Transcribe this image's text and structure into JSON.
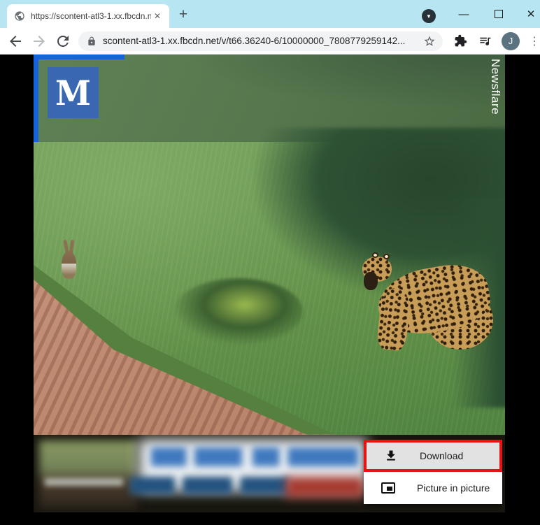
{
  "window": {
    "tab_title": "https://scontent-atl3-1.xx.fbcdn.n",
    "icons": {
      "tab_close": "✕",
      "new_tab": "+",
      "chevron_down": "▼",
      "minimize": "—",
      "close": "✕",
      "menu_dots": "⋮"
    }
  },
  "toolbar": {
    "url": "scontent-atl3-1.xx.fbcdn.net/v/t66.36240-6/10000000_7808779259142...",
    "avatar_initial": "J"
  },
  "video": {
    "brand_letter": "M",
    "watermark": "Newsflare"
  },
  "context_menu": {
    "items": [
      {
        "label": "Download",
        "icon": "download-icon",
        "highlighted": true
      },
      {
        "label": "Picture in picture",
        "icon": "picture-in-picture-icon",
        "highlighted": false
      }
    ],
    "highlight_border_color": "#e81414",
    "highlight_background": "#e2e2e2"
  },
  "colors": {
    "titlebar": "#b7e6f2",
    "omnibox": "#f1f3f4",
    "avatar": "#5b7280",
    "brand_logo_blue": "#3a67b2",
    "frame_blue": "#1565d8",
    "annotation_red": "#e81414"
  }
}
